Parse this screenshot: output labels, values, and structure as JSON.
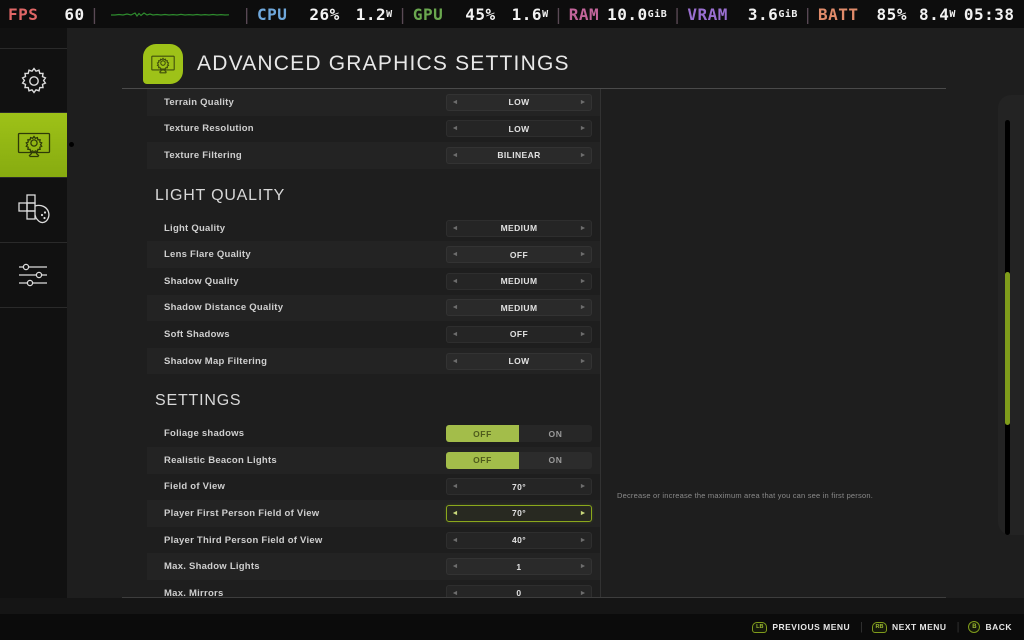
{
  "hud": {
    "items": [
      {
        "label": "FPS",
        "color": "#e06666",
        "value": "60",
        "unit": ""
      },
      {
        "label": "CPU",
        "color": "#6fa8dc",
        "value": "26%",
        "value2": "1.2",
        "unit2": "W"
      },
      {
        "label": "GPU",
        "color": "#6aa84f",
        "value": "45%",
        "value2": "1.6",
        "unit2": "W"
      },
      {
        "label": "RAM",
        "color": "#c2649a",
        "value": "10.0",
        "unit": "GiB"
      },
      {
        "label": "VRAM",
        "color": "#9a6fd0",
        "value": "3.6",
        "unit": "GiB"
      },
      {
        "label": "BATT",
        "color": "#e08b6a",
        "value": "85%",
        "value2": "8.4",
        "unit2": "W"
      }
    ],
    "clock": "05:38",
    "graph_color": "#2e8b2e"
  },
  "sidebar": {
    "items": [
      {
        "name": "general-settings",
        "icon": "gear-icon",
        "active": false
      },
      {
        "name": "graphics-settings",
        "icon": "monitor-gear-icon",
        "active": true
      },
      {
        "name": "controls-settings",
        "icon": "gamepad-icon",
        "active": false
      },
      {
        "name": "audio-settings",
        "icon": "sliders-icon",
        "active": false
      }
    ]
  },
  "header": {
    "title": "ADVANCED GRAPHICS SETTINGS",
    "icon": "monitor-gear-icon",
    "accent": "#9ec218"
  },
  "settings": {
    "groups": [
      {
        "title": "",
        "rows": [
          {
            "label": "Terrain Quality",
            "type": "stepper",
            "value": "LOW",
            "focused": false
          },
          {
            "label": "Texture Resolution",
            "type": "stepper",
            "value": "LOW",
            "focused": false
          },
          {
            "label": "Texture Filtering",
            "type": "stepper",
            "value": "BILINEAR",
            "focused": false
          }
        ]
      },
      {
        "title": "LIGHT QUALITY",
        "rows": [
          {
            "label": "Light Quality",
            "type": "stepper",
            "value": "MEDIUM",
            "focused": false
          },
          {
            "label": "Lens Flare Quality",
            "type": "stepper",
            "value": "OFF",
            "focused": false
          },
          {
            "label": "Shadow Quality",
            "type": "stepper",
            "value": "MEDIUM",
            "focused": false
          },
          {
            "label": "Shadow Distance Quality",
            "type": "stepper",
            "value": "MEDIUM",
            "focused": false
          },
          {
            "label": "Soft Shadows",
            "type": "stepper",
            "value": "OFF",
            "focused": false
          },
          {
            "label": "Shadow Map Filtering",
            "type": "stepper",
            "value": "LOW",
            "focused": false
          }
        ]
      },
      {
        "title": "SETTINGS",
        "rows": [
          {
            "label": "Foliage shadows",
            "type": "toggle",
            "options": [
              "OFF",
              "ON"
            ],
            "selected": "OFF"
          },
          {
            "label": "Realistic Beacon Lights",
            "type": "toggle",
            "options": [
              "OFF",
              "ON"
            ],
            "selected": "OFF"
          },
          {
            "label": "Field of View",
            "type": "stepper",
            "value": "70°",
            "focused": false
          },
          {
            "label": "Player First Person Field of View",
            "type": "stepper",
            "value": "70°",
            "focused": true
          },
          {
            "label": "Player Third Person Field of View",
            "type": "stepper",
            "value": "40°",
            "focused": false
          },
          {
            "label": "Max. Shadow Lights",
            "type": "stepper",
            "value": "1",
            "focused": false
          },
          {
            "label": "Max. Mirrors",
            "type": "stepper",
            "value": "0",
            "focused": false
          }
        ]
      }
    ],
    "arrow_left": "◄",
    "arrow_right": "►"
  },
  "help": {
    "text": "Decrease or increase the maximum area that you can see in first person."
  },
  "bottom_bar": {
    "actions": [
      {
        "glyph": "LB",
        "shape": "shoulder",
        "label": "PREVIOUS MENU"
      },
      {
        "glyph": "RB",
        "shape": "shoulder",
        "label": "NEXT MENU"
      },
      {
        "glyph": "B",
        "shape": "round",
        "label": "BACK"
      }
    ]
  },
  "scrollbar": {
    "thumb_color": "#7f9c1b",
    "position_percent": 37
  }
}
